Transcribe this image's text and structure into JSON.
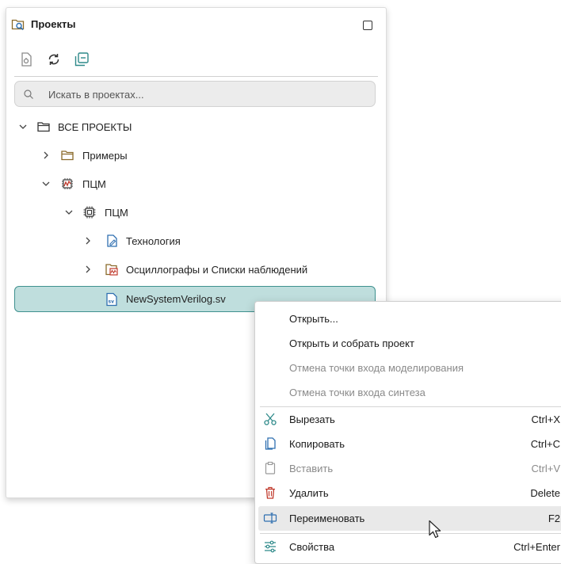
{
  "panel": {
    "title": "Проекты",
    "search_placeholder": "Искать в проектах...",
    "tree": [
      {
        "label": "ВСЕ ПРОЕКТЫ",
        "icon": "folder-icon",
        "expanded": true
      },
      {
        "label": "Примеры",
        "icon": "folder-icon",
        "expanded": false
      },
      {
        "label": "ПЦМ",
        "icon": "fpga-project-icon",
        "expanded": true
      },
      {
        "label": "ПЦМ",
        "icon": "chip-icon",
        "expanded": true
      },
      {
        "label": "Технология",
        "icon": "technology-doc-icon",
        "expanded": false
      },
      {
        "label": "Осциллографы и Списки наблюдений",
        "icon": "oscilloscope-folder-icon",
        "expanded": false
      },
      {
        "label": "NewSystemVerilog.sv",
        "icon": "sv-file-icon",
        "selected": true
      }
    ]
  },
  "menu": {
    "items": [
      {
        "label": "Открыть...",
        "enabled": true
      },
      {
        "label": "Открыть и собрать проект",
        "enabled": true
      },
      {
        "label": "Отмена точки входа моделирования",
        "enabled": false
      },
      {
        "label": "Отмена точки входа синтеза",
        "enabled": false
      },
      {
        "label": "Вырезать",
        "shortcut": "Ctrl+X",
        "icon": "scissors-icon",
        "enabled": true
      },
      {
        "label": "Копировать",
        "shortcut": "Ctrl+C",
        "icon": "copy-icon",
        "enabled": true
      },
      {
        "label": "Вставить",
        "shortcut": "Ctrl+V",
        "icon": "paste-icon",
        "enabled": false
      },
      {
        "label": "Удалить",
        "shortcut": "Delete",
        "icon": "trash-icon",
        "enabled": true
      },
      {
        "label": "Переименовать",
        "shortcut": "F2",
        "icon": "rename-icon",
        "enabled": true,
        "hovered": true
      },
      {
        "label": "Свойства",
        "shortcut": "Ctrl+Enter",
        "icon": "properties-icon",
        "enabled": true
      }
    ]
  },
  "colors": {
    "selection_bg": "#bfdedd",
    "selection_border": "#3f918f",
    "icon_teal": "#2f8a8a",
    "delete_red": "#c0392b",
    "folder_brown": "#8a6a2a"
  }
}
